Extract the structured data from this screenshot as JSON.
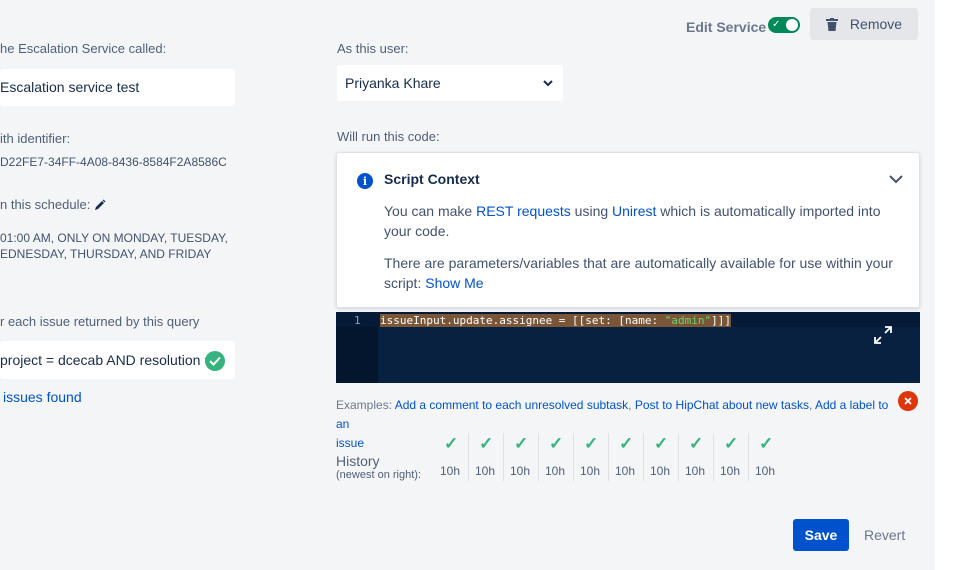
{
  "left": {
    "service_label": "he Escalation Service called:",
    "service_name": "Escalation service test",
    "identifier_label": "ith identifier:",
    "identifier_value": "D22FE7-34FF-4A08-8436-8584F2A8586C",
    "schedule_label": "n this schedule:",
    "schedule_line1": "01:00 AM, ONLY ON MONDAY, TUESDAY,",
    "schedule_line2": "EDNESDAY, THURSDAY, AND FRIDAY",
    "query_label": "r each issue returned by this query",
    "query_value": "project = dcecab AND resolution =",
    "issues_found": "issues found"
  },
  "header": {
    "edit_service": "Edit Service",
    "remove": "Remove"
  },
  "user": {
    "label": "As this user:",
    "value": "Priyanka Khare"
  },
  "code_section": {
    "label": "Will run this code:"
  },
  "script_context": {
    "title": "Script Context",
    "p1_a": "You can make ",
    "p1_link1": "REST requests",
    "p1_b": " using ",
    "p1_link2": "Unirest",
    "p1_c": " which is automatically imported into",
    "p1_d": "your code.",
    "p2_a": "There are parameters/variables that are automatically available for use within your",
    "p2_b": "script: ",
    "p2_link": "Show Me"
  },
  "editor": {
    "line_number": "1",
    "code_part1": "issueInput.update.assignee = [[set: [name: ",
    "code_string": "\"admin\"",
    "code_part2": "]]]"
  },
  "examples": {
    "prefix": "Examples: ",
    "item1": "Add a comment to each unresolved subtask",
    "sep1": ", ",
    "item2": "Post to HipChat about new tasks",
    "sep2": ", ",
    "item3a": "Add a label to an",
    "item3b": "issue"
  },
  "history": {
    "label": "History",
    "sublabel": "(newest on right):",
    "entries": [
      "10h",
      "10h",
      "10h",
      "10h",
      "10h",
      "10h",
      "10h",
      "10h",
      "10h",
      "10h"
    ]
  },
  "actions": {
    "save": "Save",
    "revert": "Revert"
  },
  "colors": {
    "primary": "#0052cc",
    "success": "#00875a",
    "error": "#de350b",
    "editor_bg": "#082140"
  }
}
